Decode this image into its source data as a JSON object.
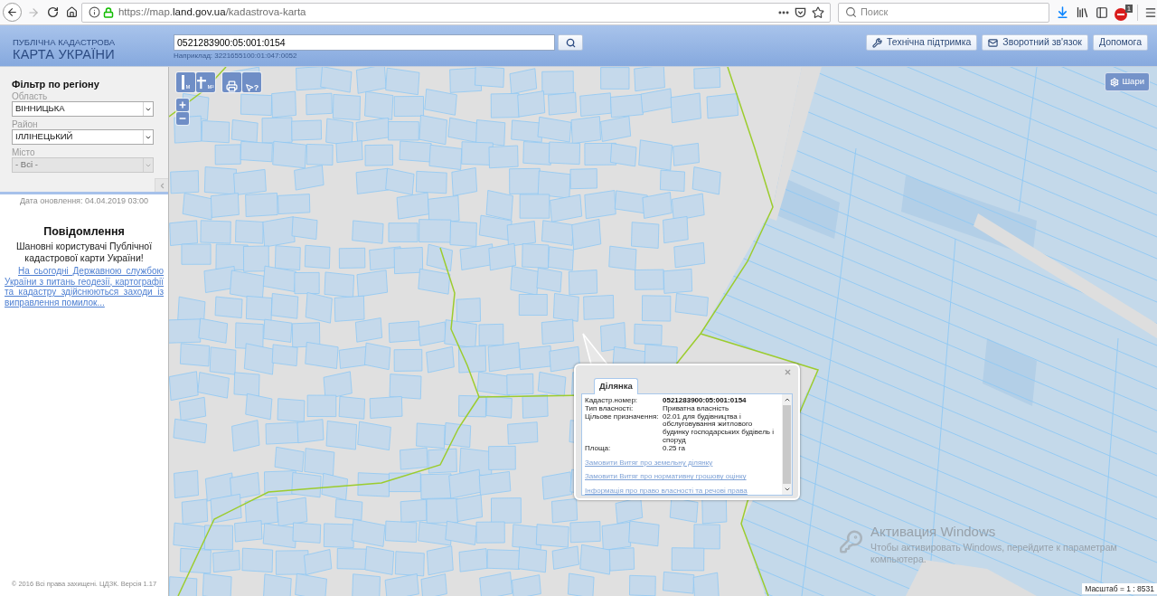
{
  "browser": {
    "address": {
      "prefix": "https://map.",
      "domain": "land.gov.ua",
      "path": "/kadastrova-karta"
    },
    "search": {
      "placeholder": "Поиск"
    },
    "extension_badge": "1"
  },
  "header": {
    "logo": {
      "line_1": "ПУБЛІЧНА КАДАСТРОВА",
      "line_2": "КАРТА УКРАЇНИ"
    },
    "search": {
      "value": "0521283900:05:001:0154",
      "hint": "Наприклад: 3221655100:01:047:0052"
    },
    "buttons": [
      {
        "kind": "support",
        "label": "Технічна підтримка"
      },
      {
        "kind": "feedback",
        "label": "Зворотний зв'язок"
      },
      {
        "kind": "help",
        "label": "Допомога"
      }
    ]
  },
  "sidebar": {
    "filter": {
      "title": "Фільтр по регіону",
      "fields": [
        {
          "label": "Область",
          "value": "ВІННИЦЬКА",
          "disabled": false
        },
        {
          "label": "Район",
          "value": "ІЛЛІНЕЦЬКИЙ",
          "disabled": false
        },
        {
          "label": "Місто",
          "value": "- Всі -",
          "disabled": true
        }
      ]
    },
    "updated": "Дата оновлення: 04.04.2019 03:00",
    "notice": {
      "title": "Повідомлення",
      "greeting": "Шановні користувачі Публічної кадастрової карти України!",
      "link": "На сьогодні Державною службою України з питань геодезії, картографії та кадастру здійснюються заходи із виправлення помилок..."
    },
    "footer": "© 2016 Всі права захищені. ЦДЗК. Версія 1.17"
  },
  "map": {
    "tool_groups": [
      [
        {
          "kind": "distance",
          "label": "м"
        },
        {
          "kind": "area",
          "label": "м²"
        }
      ],
      [
        {
          "kind": "print"
        },
        {
          "kind": "identify",
          "label": "?"
        }
      ]
    ],
    "layers_button": "Шари",
    "popup": {
      "tabs": [
        {
          "label": "Ділянка",
          "selected": true
        }
      ],
      "fields": [
        {
          "label": "Кадастр.номер:",
          "value": "0521283900:05:001:0154"
        },
        {
          "label": "Тип власності:",
          "value": "Приватна власність"
        },
        {
          "label": "Цільове призначення:",
          "value": "02.01 для будівництва і обслуговування житлового будинку господарських будівель і споруд"
        },
        {
          "label": "Площа:",
          "value": "0.25 га"
        }
      ],
      "links": [
        "Замовити Витяг про земельну ділянку",
        "Замовити Витяг про нормативну грошову оцінку",
        "Інформація про право власності та речові права"
      ]
    },
    "scale": "Масштаб = 1 : 8531"
  },
  "os_notice": {
    "title": "Активация Windows",
    "text": "Чтобы активировать Windows, перейдите к параметрам компьютера."
  }
}
